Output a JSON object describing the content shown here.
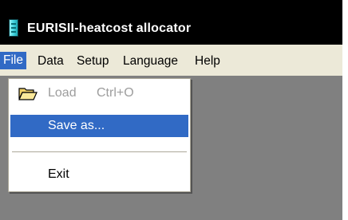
{
  "window": {
    "title": "EURISII-heatcost allocator",
    "icon": "app-icon"
  },
  "menubar": {
    "items": [
      {
        "label": "File",
        "active": true
      },
      {
        "label": "Data"
      },
      {
        "label": "Setup"
      },
      {
        "label": "Language"
      },
      {
        "label": "Help"
      }
    ]
  },
  "file_menu": {
    "items": [
      {
        "label": "Load",
        "shortcut": "Ctrl+O",
        "enabled": false,
        "icon": "open-folder-icon"
      },
      {
        "label": "Save as...",
        "highlighted": true
      },
      {
        "label": "Exit"
      }
    ]
  },
  "colors": {
    "menu_highlight": "#316ac5",
    "menubar_bg": "#ece9d8",
    "client_bg": "#808080"
  }
}
